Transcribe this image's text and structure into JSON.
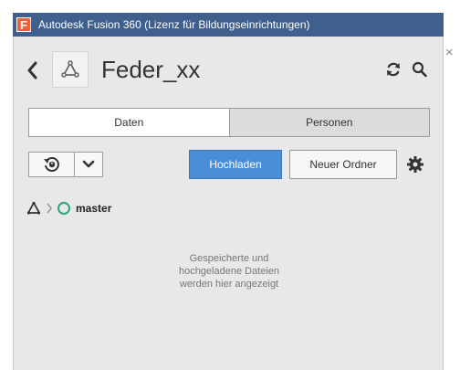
{
  "window": {
    "title": "Autodesk Fusion 360 (Lizenz für Bildungseinrichtungen)",
    "logo_letter": "F",
    "close_glyph": "×"
  },
  "header": {
    "back_icon": "chevron-left-icon",
    "project_icon": "hub-triangle-icon",
    "project_title": "Feder_xx",
    "refresh_icon": "refresh-icon",
    "search_icon": "search-icon"
  },
  "tabs": [
    {
      "label": "Daten",
      "active": true
    },
    {
      "label": "Personen",
      "active": false
    }
  ],
  "toolbar": {
    "history_icon": "history-icon",
    "dropdown_icon": "chevron-down-icon",
    "upload_label": "Hochladen",
    "new_folder_label": "Neuer Ordner",
    "settings_icon": "gear-icon"
  },
  "breadcrumb": {
    "root_icon": "hub-triangle-icon",
    "branch_label": "master",
    "branch_icon": "branch-circle-icon"
  },
  "empty_state": {
    "line1": "Gespeicherte und",
    "line2": "hochgeladene Dateien",
    "line3": "werden hier angezeigt"
  },
  "colors": {
    "titlebar": "#3f5f8c",
    "logo": "#e8623a",
    "panel_bg": "#e8e8e8",
    "upload_button": "#4a8fd6",
    "branch_circle": "#2aa77a"
  }
}
